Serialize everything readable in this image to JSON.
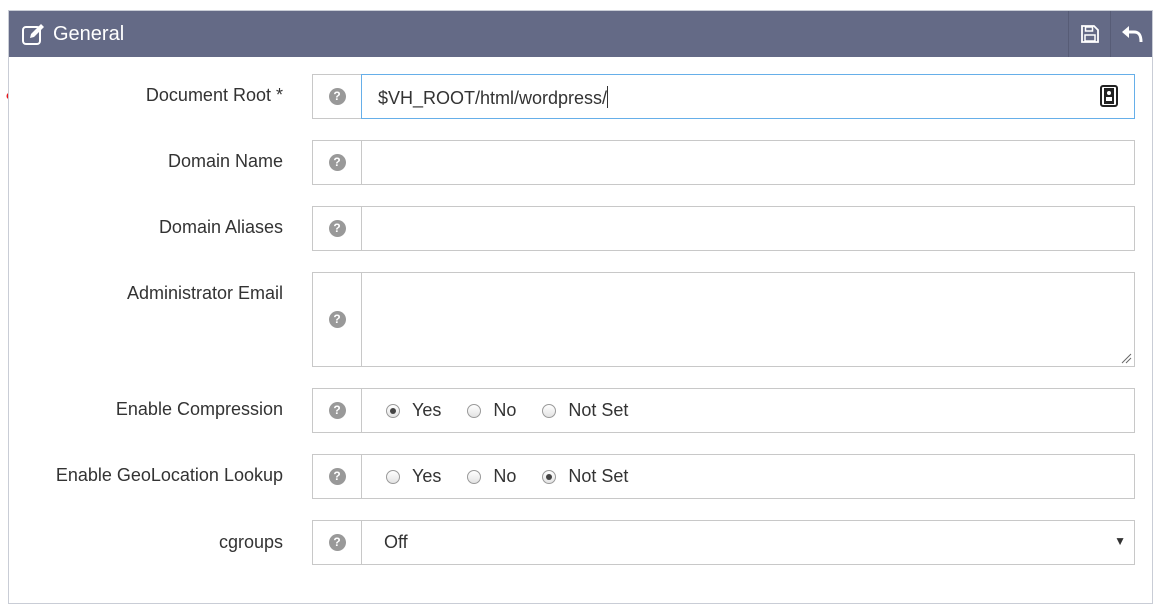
{
  "header": {
    "title": "General",
    "edit_icon": "edit-icon",
    "save_icon": "floppy-disk-icon",
    "back_icon": "undo-arrow-icon"
  },
  "annotation": {
    "arrow_color": "#e8151b"
  },
  "fields": {
    "document_root": {
      "label": "Document Root *",
      "value": "$VH_ROOT/html/wordpress/"
    },
    "domain_name": {
      "label": "Domain Name",
      "value": ""
    },
    "domain_aliases": {
      "label": "Domain Aliases",
      "value": ""
    },
    "admin_email": {
      "label": "Administrator Email",
      "value": ""
    },
    "enable_compression": {
      "label": "Enable Compression",
      "options": [
        "Yes",
        "No",
        "Not Set"
      ],
      "selected": "Yes"
    },
    "enable_geolocation": {
      "label": "Enable GeoLocation Lookup",
      "options": [
        "Yes",
        "No",
        "Not Set"
      ],
      "selected": "Not Set"
    },
    "cgroups": {
      "label": "cgroups",
      "selected": "Off"
    }
  },
  "colors": {
    "header_bg": "#646a86",
    "focus_border": "#66afe9",
    "help_icon": "#999999"
  }
}
